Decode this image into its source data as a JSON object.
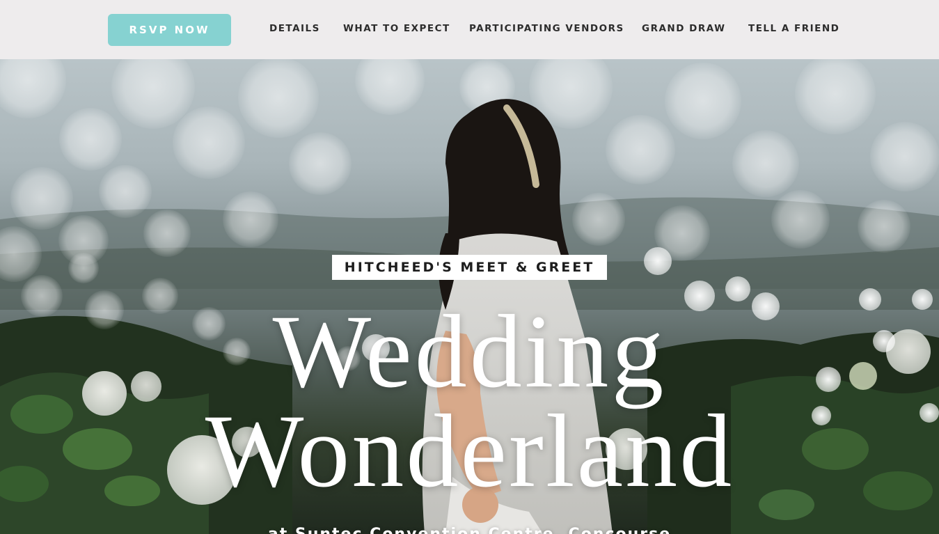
{
  "nav": {
    "rsvp_label": "RSVP NOW",
    "items": [
      {
        "label": "DETAILS"
      },
      {
        "label": "WHAT TO EXPECT"
      },
      {
        "label": "PARTICIPATING VENDORS"
      },
      {
        "label": "GRAND DRAW"
      },
      {
        "label": "TELL A FRIEND"
      }
    ]
  },
  "hero": {
    "badge": "HITCHEED'S MEET & GREET",
    "title_line1": "Wedding",
    "title_line2": "Wonderland",
    "venue": "at Suntec Convention Centre, Concourse"
  },
  "colors": {
    "topbar_bg": "#eeeced",
    "rsvp_bg": "#86d2d1",
    "nav_text": "#2c2c2c",
    "badge_bg": "#ffffff",
    "hero_text": "#ffffff"
  },
  "icons": {
    "hero_image": "bride-in-flower-field-photo"
  }
}
